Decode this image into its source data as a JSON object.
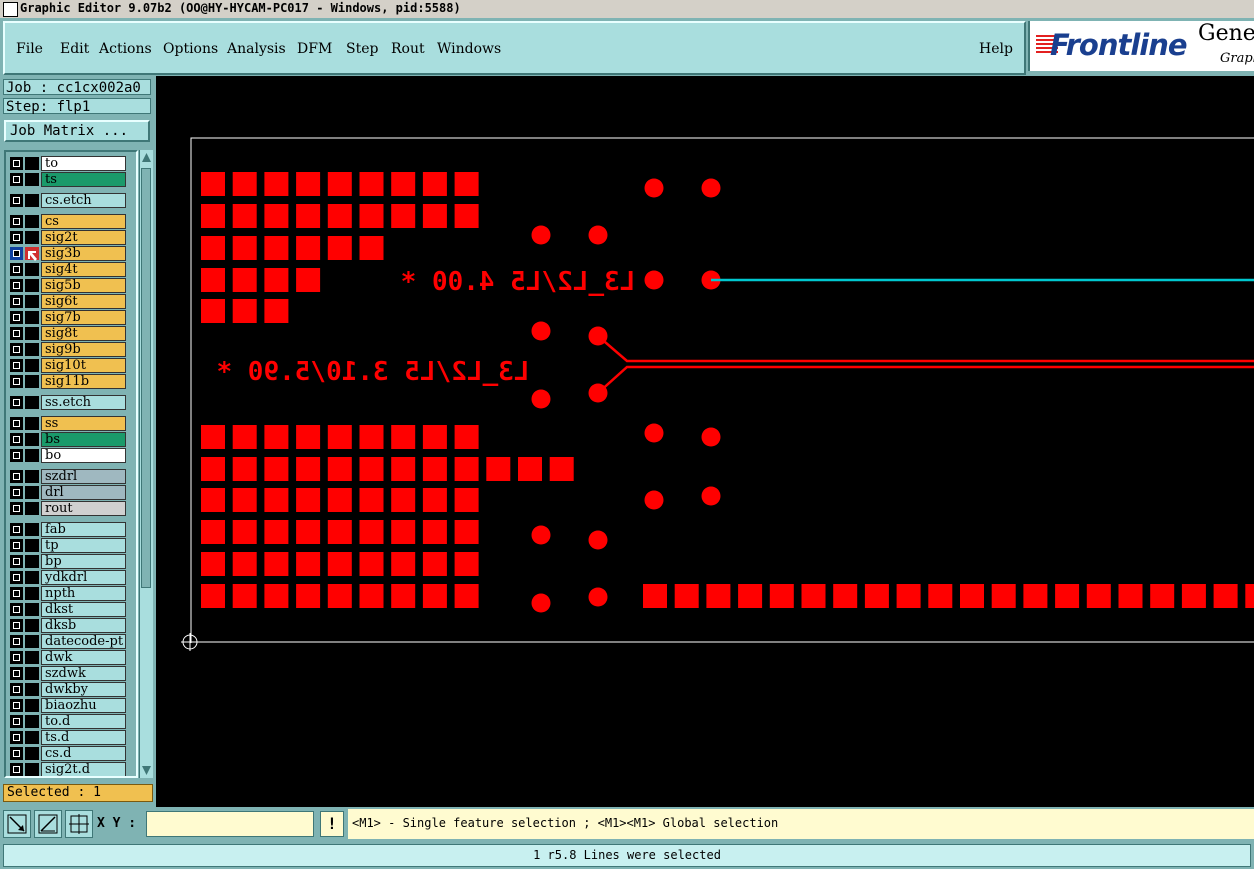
{
  "window": {
    "title": "Graphic Editor 9.07b2 (OO@HY-HYCAM-PC017 - Windows, pid:5588)"
  },
  "menu": {
    "items": [
      {
        "label": "File"
      },
      {
        "label": "Edit"
      },
      {
        "label": "Actions"
      },
      {
        "label": "Options"
      },
      {
        "label": "Analysis"
      },
      {
        "label": "DFM"
      },
      {
        "label": "Step"
      },
      {
        "label": "Rout"
      },
      {
        "label": "Windows"
      }
    ],
    "help": "Help"
  },
  "logo": {
    "brand": "Frontline",
    "product": "Genes",
    "sub": "Graphi"
  },
  "job": {
    "job_label": "Job : cc1cx002a0",
    "step_label": "Step: flp1",
    "matrix_button": "Job Matrix ..."
  },
  "layers": [
    {
      "name": "to",
      "color": "#ffffff"
    },
    {
      "name": "ts",
      "color": "#1a9a6a"
    },
    {
      "name": "cs.etch",
      "color": "#a9dede"
    },
    {
      "name": "cs",
      "color": "#f0c050"
    },
    {
      "name": "sig2t",
      "color": "#f0c050"
    },
    {
      "name": "sig3b",
      "color": "#f0c050",
      "selected": true
    },
    {
      "name": "sig4t",
      "color": "#f0c050"
    },
    {
      "name": "sig5b",
      "color": "#f0c050"
    },
    {
      "name": "sig6t",
      "color": "#f0c050"
    },
    {
      "name": "sig7b",
      "color": "#f0c050"
    },
    {
      "name": "sig8t",
      "color": "#f0c050"
    },
    {
      "name": "sig9b",
      "color": "#f0c050"
    },
    {
      "name": "sig10t",
      "color": "#f0c050"
    },
    {
      "name": "sig11b",
      "color": "#f0c050"
    },
    {
      "name": "ss.etch",
      "color": "#a9dede"
    },
    {
      "name": "ss",
      "color": "#f0c050"
    },
    {
      "name": "bs",
      "color": "#1a9a6a"
    },
    {
      "name": "bo",
      "color": "#ffffff"
    },
    {
      "name": "szdrl",
      "color": "#9fb8c0"
    },
    {
      "name": "drl",
      "color": "#9fb8c0"
    },
    {
      "name": "rout",
      "color": "#d0d0d0"
    },
    {
      "name": "fab",
      "color": "#a9dede"
    },
    {
      "name": "tp",
      "color": "#a9dede"
    },
    {
      "name": "bp",
      "color": "#a9dede"
    },
    {
      "name": "ydkdrl",
      "color": "#a9dede"
    },
    {
      "name": "npth",
      "color": "#a9dede"
    },
    {
      "name": "dkst",
      "color": "#a9dede"
    },
    {
      "name": "dksb",
      "color": "#a9dede"
    },
    {
      "name": "datecode-pt",
      "color": "#a9dede"
    },
    {
      "name": "dwk",
      "color": "#a9dede"
    },
    {
      "name": "szdwk",
      "color": "#a9dede"
    },
    {
      "name": "dwkby",
      "color": "#a9dede"
    },
    {
      "name": "biaozhu",
      "color": "#a9dede"
    },
    {
      "name": "to.d",
      "color": "#a9dede"
    },
    {
      "name": "ts.d",
      "color": "#a9dede"
    },
    {
      "name": "cs.d",
      "color": "#a9dede"
    },
    {
      "name": "sig2t.d",
      "color": "#a9dede"
    }
  ],
  "selected_count": "Selected : 1",
  "bottom": {
    "xy_label": "X Y :",
    "xy_value": "",
    "exclaim": "!",
    "prompt": "<M1> - Single feature selection ; <M1><M1> Global selection"
  },
  "status": "1 r5.8 Lines were selected",
  "canvas": {
    "text_upper": "L3_L2/L5 4.00 *",
    "text_lower": "L3_L2/L5 3.10/5.90 *",
    "colors": {
      "feature": "#ff0000",
      "highlight": "#00c8d0",
      "profile": "#ffffff"
    }
  }
}
